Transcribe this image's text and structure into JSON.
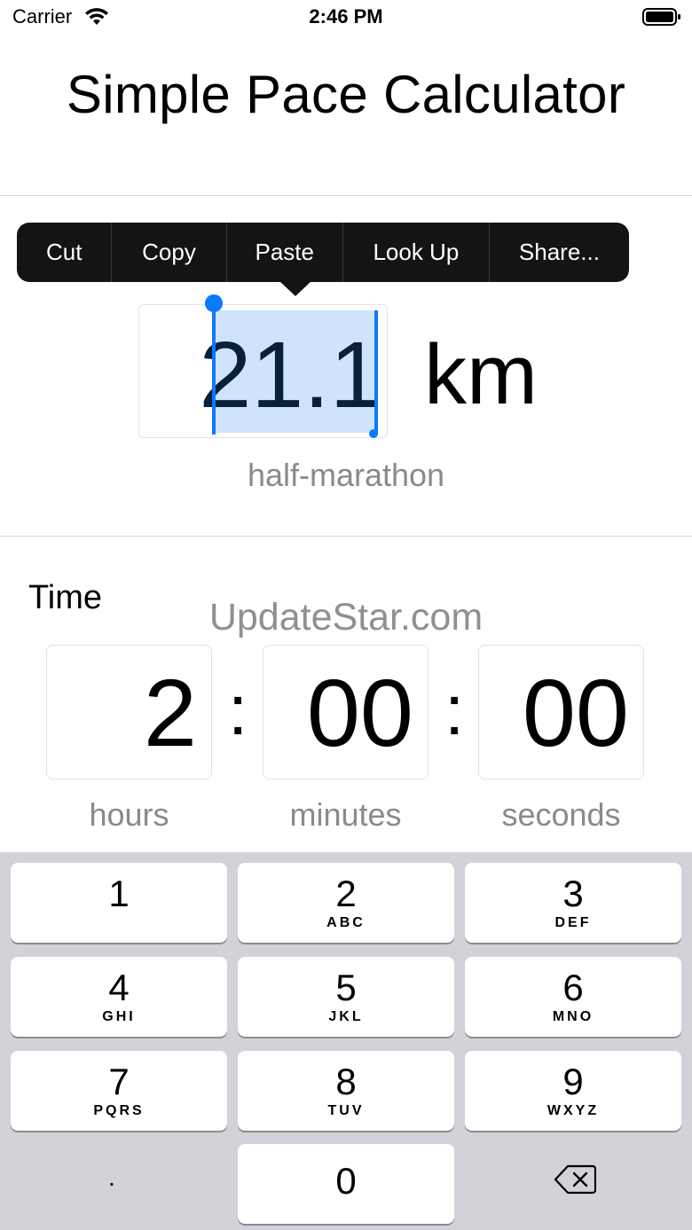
{
  "status_bar": {
    "carrier": "Carrier",
    "time": "2:46 PM",
    "wifi_icon": "wifi-icon",
    "battery_icon": "battery-icon"
  },
  "title": "Simple Pace Calculator",
  "context_menu": {
    "items": [
      "Cut",
      "Copy",
      "Paste",
      "Look Up",
      "Share..."
    ]
  },
  "distance": {
    "value": "21.1",
    "unit": "km",
    "label": "half-marathon"
  },
  "time": {
    "label": "Time",
    "hours": "2",
    "minutes": "00",
    "seconds": "00",
    "separator": ":",
    "hours_label": "hours",
    "minutes_label": "minutes",
    "seconds_label": "seconds"
  },
  "watermark": "UpdateStar.com",
  "keyboard": {
    "keys": [
      {
        "num": "1",
        "letters": ""
      },
      {
        "num": "2",
        "letters": "ABC"
      },
      {
        "num": "3",
        "letters": "DEF"
      },
      {
        "num": "4",
        "letters": "GHI"
      },
      {
        "num": "5",
        "letters": "JKL"
      },
      {
        "num": "6",
        "letters": "MNO"
      },
      {
        "num": "7",
        "letters": "PQRS"
      },
      {
        "num": "8",
        "letters": "TUV"
      },
      {
        "num": "9",
        "letters": "WXYZ"
      },
      {
        "num": "0",
        "letters": ""
      }
    ],
    "decimal": ".",
    "delete_icon": "backspace-icon"
  },
  "colors": {
    "accent": "#0a7aff",
    "selection": "#cfe3fb",
    "menu_bg": "#141414",
    "keyboard_bg": "#d1d3d9",
    "secondary_text": "#8a8a8e"
  }
}
